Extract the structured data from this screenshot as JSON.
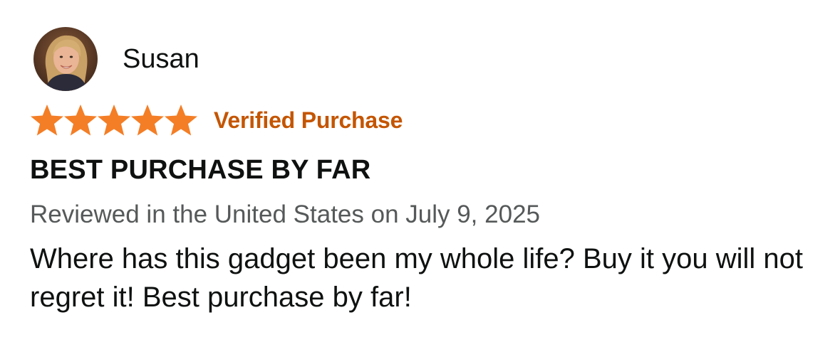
{
  "reviewer": {
    "name": "Susan",
    "avatar_icon": "reviewer-photo"
  },
  "rating": {
    "stars": 5,
    "max_stars": 5,
    "star_color": "#f47e26",
    "star_icon": "star-icon"
  },
  "verified_label": "Verified Purchase",
  "verified_color": "#c45500",
  "review_title": "BEST PURCHASE BY FAR",
  "review_meta": "Reviewed in the United States on July 9, 2025",
  "review_body": "Where has this gadget been my whole life? Buy it you will not regret it! Best purchase by far!"
}
